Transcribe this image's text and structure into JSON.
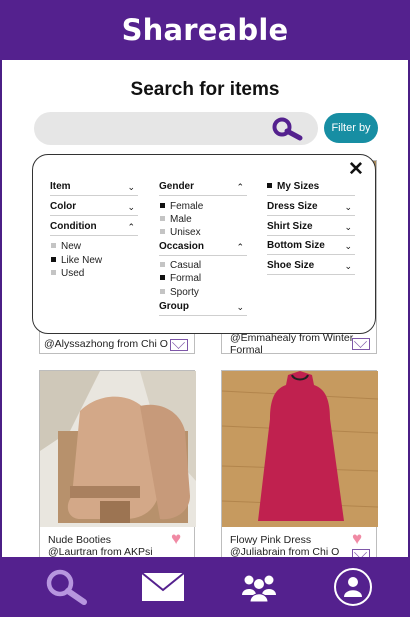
{
  "app": {
    "title": "Shareable"
  },
  "search": {
    "title": "Search for items",
    "placeholder": "",
    "filter_label": "Filter by"
  },
  "filters": {
    "col1": {
      "item": "Item",
      "color": "Color",
      "condition": "Condition",
      "condition_options": [
        {
          "label": "New",
          "checked": false
        },
        {
          "label": "Like New",
          "checked": true
        },
        {
          "label": "Used",
          "checked": false
        }
      ]
    },
    "col2": {
      "gender": "Gender",
      "gender_options": [
        {
          "label": "Female",
          "checked": true
        },
        {
          "label": "Male",
          "checked": false
        },
        {
          "label": "Unisex",
          "checked": false
        }
      ],
      "occasion": "Occasion",
      "occasion_options": [
        {
          "label": "Casual",
          "checked": false
        },
        {
          "label": "Formal",
          "checked": true
        },
        {
          "label": "Sporty",
          "checked": false
        }
      ],
      "group": "Group"
    },
    "col3": {
      "my_sizes": "My Sizes",
      "my_sizes_checked": true,
      "dress_size": "Dress Size",
      "shirt_size": "Shirt Size",
      "bottom_size": "Bottom Size",
      "shoe_size": "Shoe Size"
    }
  },
  "items": [
    {
      "caption": "@Alyssazhong from Chi O"
    },
    {
      "caption_line1": "@Emmahealy from Winter",
      "caption_line2": "Formal"
    },
    {
      "name": "Nude Booties",
      "owner": "@Laurtran from AKPsi"
    },
    {
      "name": "Flowy Pink Dress",
      "owner": "@Juliabrain from Chi O"
    }
  ],
  "nav": [
    "search-icon",
    "mail-icon",
    "group-icon",
    "profile-icon"
  ],
  "colors": {
    "brand": "#54218e",
    "accent": "#178ea3",
    "heart": "#f08aa4"
  }
}
